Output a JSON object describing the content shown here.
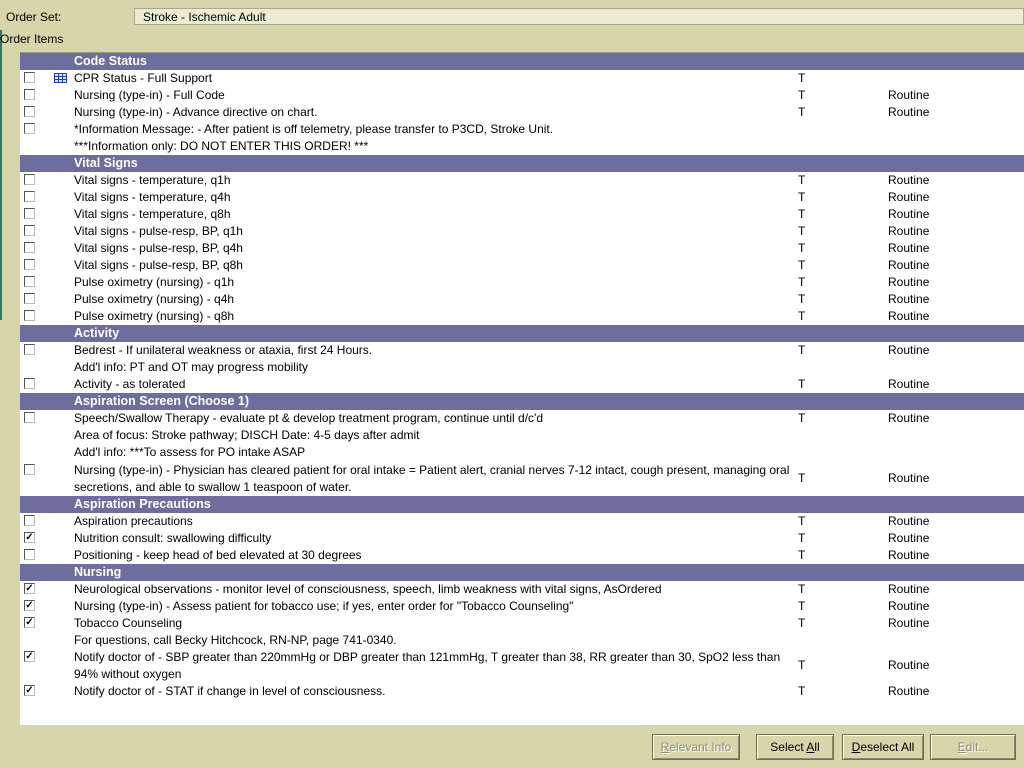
{
  "header": {
    "order_set_label": "Order Set:",
    "order_set_value": "Stroke - Ischemic Adult",
    "order_items_label": "Order Items"
  },
  "sections": [
    {
      "title": "Code Status",
      "rows": [
        {
          "checked": false,
          "icon": "grid-icon",
          "lines": [
            "CPR Status - Full Support"
          ],
          "type": "T",
          "priority": ""
        },
        {
          "checked": false,
          "lines": [
            "Nursing (type-in) - Full Code"
          ],
          "type": "T",
          "priority": "Routine"
        },
        {
          "checked": false,
          "lines": [
            "Nursing (type-in) - Advance directive on chart."
          ],
          "type": "T",
          "priority": "Routine"
        },
        {
          "checked": false,
          "lines": [
            "*Information Message: - After patient is off telemetry, please transfer to P3CD, Stroke Unit.",
            "***Information only:  DO NOT ENTER THIS ORDER! ***"
          ],
          "type": "",
          "priority": ""
        }
      ]
    },
    {
      "title": "Vital Signs",
      "rows": [
        {
          "checked": false,
          "lines": [
            "Vital signs - temperature, q1h"
          ],
          "type": "T",
          "priority": "Routine"
        },
        {
          "checked": false,
          "lines": [
            "Vital signs - temperature, q4h"
          ],
          "type": "T",
          "priority": "Routine"
        },
        {
          "checked": false,
          "lines": [
            "Vital signs - temperature, q8h"
          ],
          "type": "T",
          "priority": "Routine"
        },
        {
          "checked": false,
          "lines": [
            "Vital signs - pulse-resp, BP, q1h"
          ],
          "type": "T",
          "priority": "Routine"
        },
        {
          "checked": false,
          "lines": [
            "Vital signs - pulse-resp, BP, q4h"
          ],
          "type": "T",
          "priority": "Routine"
        },
        {
          "checked": false,
          "lines": [
            "Vital signs - pulse-resp, BP, q8h"
          ],
          "type": "T",
          "priority": "Routine"
        },
        {
          "checked": false,
          "lines": [
            "Pulse oximetry (nursing) - q1h"
          ],
          "type": "T",
          "priority": "Routine"
        },
        {
          "checked": false,
          "lines": [
            "Pulse oximetry (nursing) - q4h"
          ],
          "type": "T",
          "priority": "Routine"
        },
        {
          "checked": false,
          "lines": [
            "Pulse oximetry (nursing) - q8h"
          ],
          "type": "T",
          "priority": "Routine"
        }
      ]
    },
    {
      "title": "Activity",
      "rows": [
        {
          "checked": false,
          "lines": [
            "Bedrest - If unilateral weakness or ataxia, first 24 Hours.",
            "Add'l info: PT and OT may progress mobility"
          ],
          "type": "T",
          "priority": "Routine"
        },
        {
          "checked": false,
          "lines": [
            "Activity - as tolerated"
          ],
          "type": "T",
          "priority": "Routine"
        }
      ]
    },
    {
      "title": "Aspiration Screen (Choose 1)",
      "rows": [
        {
          "checked": false,
          "lines": [
            "Speech/Swallow Therapy - evaluate pt & develop treatment program, continue until d/c'd",
            "Area of focus: Stroke pathway; DISCH Date: 4-5 days after admit",
            "Add'l info: ***To assess for PO intake ASAP"
          ],
          "type": "T",
          "priority": "Routine"
        },
        {
          "checked": false,
          "lines": [
            "Nursing (type-in) - Physician has cleared patient for oral intake = Patient alert, cranial nerves 7-12 intact, cough present, managing oral",
            "secretions, and able to swallow 1 teaspoon of water."
          ],
          "type": "T",
          "priority": "Routine",
          "value_on_second": true
        }
      ]
    },
    {
      "title": "Aspiration Precautions",
      "rows": [
        {
          "checked": false,
          "lines": [
            "Aspiration precautions"
          ],
          "type": "T",
          "priority": "Routine"
        },
        {
          "checked": true,
          "lines": [
            "Nutrition consult: swallowing difficulty"
          ],
          "type": "T",
          "priority": "Routine"
        },
        {
          "checked": false,
          "lines": [
            "Positioning - keep head of bed elevated at 30 degrees"
          ],
          "type": "T",
          "priority": "Routine"
        }
      ]
    },
    {
      "title": "Nursing",
      "rows": [
        {
          "checked": true,
          "lines": [
            "Neurological observations -  monitor level of consciousness, speech, limb weakness with vital signs, AsOrdered"
          ],
          "type": "T",
          "priority": "Routine"
        },
        {
          "checked": true,
          "lines": [
            "Nursing (type-in) - Assess patient for tobacco use; if yes, enter order for \"Tobacco Counseling\""
          ],
          "type": "T",
          "priority": "Routine"
        },
        {
          "checked": true,
          "lines": [
            "Tobacco Counseling",
            "For questions, call Becky Hitchcock, RN-NP, page 741-0340."
          ],
          "type": "T",
          "priority": "Routine"
        },
        {
          "checked": true,
          "lines": [
            "Notify doctor of - SBP greater than 220mmHg or DBP greater than 121mmHg, T greater than 38, RR greater than 30, SpO2 less than",
            "94% without oxygen"
          ],
          "type": "T",
          "priority": "Routine",
          "value_on_second": true
        },
        {
          "checked": true,
          "lines": [
            "Notify doctor of - STAT if change in level of consciousness."
          ],
          "type": "T",
          "priority": "Routine"
        }
      ]
    }
  ],
  "buttons": {
    "relevant_info": {
      "pre": "",
      "accel": "R",
      "post": "elevant Info",
      "enabled": false
    },
    "select_all": {
      "pre": "Select ",
      "accel": "A",
      "post": "ll",
      "enabled": true
    },
    "deselect_all": {
      "pre": "",
      "accel": "D",
      "post": "eselect All",
      "enabled": true
    },
    "edit": {
      "pre": "",
      "accel": "E",
      "post": "dit...",
      "enabled": false
    }
  }
}
